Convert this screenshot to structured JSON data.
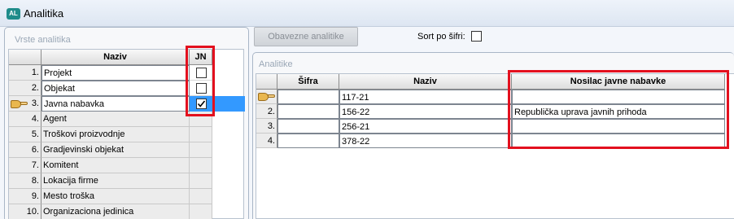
{
  "window": {
    "title": "Analitika",
    "icon": "app-icon",
    "icon_text": "AL"
  },
  "left_panel": {
    "title": "Vrste analitika",
    "columns": {
      "naziv": "Naziv",
      "jn": "JN"
    },
    "rows": [
      {
        "num": "1.",
        "naziv": "Projekt",
        "jn": false,
        "has_jn": true
      },
      {
        "num": "2.",
        "naziv": "Objekat",
        "jn": false,
        "has_jn": true
      },
      {
        "num": "3.",
        "naziv": "Javna nabavka",
        "jn": true,
        "has_jn": true,
        "selected": true
      },
      {
        "num": "4.",
        "naziv": "Agent",
        "has_jn": false
      },
      {
        "num": "5.",
        "naziv": "Troškovi proizvodnje",
        "has_jn": false
      },
      {
        "num": "6.",
        "naziv": "Gradjevinski objekat",
        "has_jn": false
      },
      {
        "num": "7.",
        "naziv": "Komitent",
        "has_jn": false
      },
      {
        "num": "8.",
        "naziv": "Lokacija firme",
        "has_jn": false
      },
      {
        "num": "9.",
        "naziv": "Mesto troška",
        "has_jn": false
      },
      {
        "num": "10.",
        "naziv": "Organizaciona jedinica",
        "has_jn": false
      }
    ]
  },
  "toolbar": {
    "obavezne_label": "Obavezne analitike",
    "sort_label": "Sort po šifri:",
    "sort_checked": false
  },
  "right_panel": {
    "title": "Analitike",
    "columns": {
      "sifra": "Šifra",
      "naziv": "Naziv",
      "nosilac": "Nosilac javne nabavke"
    },
    "rows": [
      {
        "num": "",
        "sifra": "",
        "naziv": "117-21",
        "nosilac": "",
        "current": true
      },
      {
        "num": "2.",
        "sifra": "",
        "naziv": "156-22",
        "nosilac": "Republička uprava javnih prihoda"
      },
      {
        "num": "3.",
        "sifra": "",
        "naziv": "256-21",
        "nosilac": ""
      },
      {
        "num": "4.",
        "sifra": "",
        "naziv": "378-22",
        "nosilac": ""
      }
    ]
  },
  "colors": {
    "selection": "#3399ff",
    "highlight_box": "#e3101e"
  }
}
